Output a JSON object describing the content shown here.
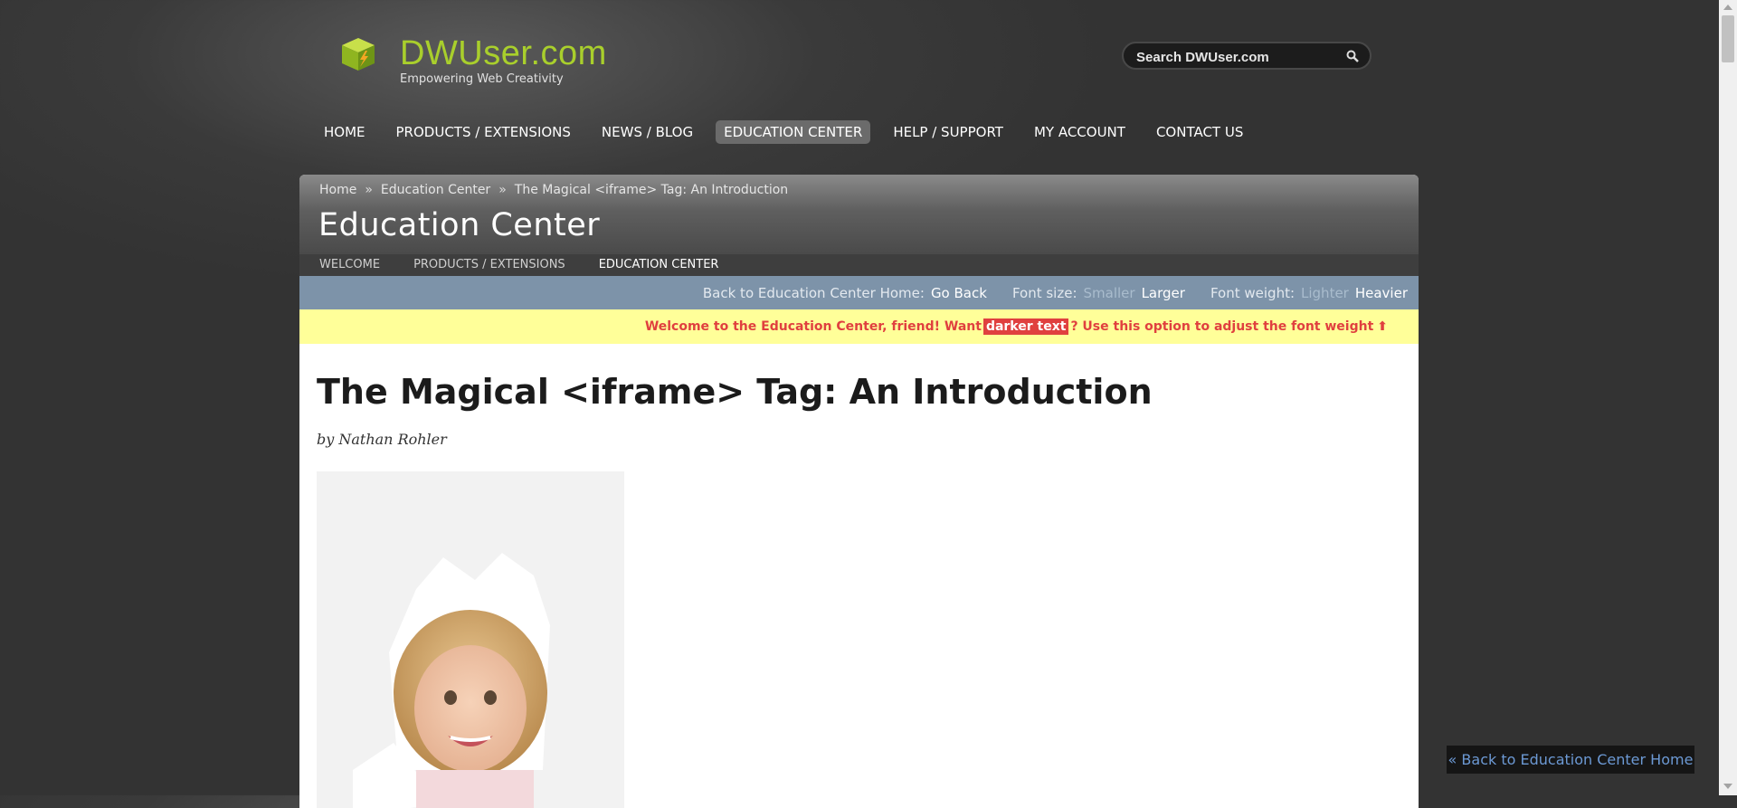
{
  "header": {
    "logo_text": "DWUser.com",
    "tagline": "Empowering Web Creativity",
    "search_placeholder": "Search DWUser.com"
  },
  "main_nav": {
    "items": [
      {
        "label": "HOME"
      },
      {
        "label": "PRODUCTS / EXTENSIONS"
      },
      {
        "label": "NEWS / BLOG"
      },
      {
        "label": "EDUCATION CENTER",
        "active": true
      },
      {
        "label": "HELP / SUPPORT"
      },
      {
        "label": "MY ACCOUNT"
      },
      {
        "label": "CONTACT US"
      }
    ]
  },
  "breadcrumb": {
    "items": [
      "Home",
      "Education Center",
      "The Magical <iframe> Tag: An Introduction"
    ],
    "separator": "»"
  },
  "section": {
    "title": "Education Center",
    "subnav": [
      "WELCOME",
      "PRODUCTS / EXTENSIONS",
      "EDUCATION CENTER"
    ]
  },
  "toolbar": {
    "back_label": "Back to Education Center Home:",
    "back_action": "Go Back",
    "font_size_label": "Font size:",
    "smaller": "Smaller",
    "larger": "Larger",
    "font_weight_label": "Font weight:",
    "lighter": "Lighter",
    "heavier": "Heavier"
  },
  "notice": {
    "before": "Welcome to the Education Center, friend!  Want",
    "highlight": "darker text",
    "after": "?  Use this option to adjust the font weight",
    "arrow": "⬆"
  },
  "article": {
    "title": "The Magical <iframe> Tag: An Introduction",
    "byline": "by Nathan Rohler"
  },
  "floating_button": "« Back to Education Center Home",
  "colors": {
    "brand_green": "#a9cf2c",
    "toolbar_blue": "#7d93a9",
    "notice_yellow": "#ffff99",
    "notice_red": "#e0403f"
  }
}
